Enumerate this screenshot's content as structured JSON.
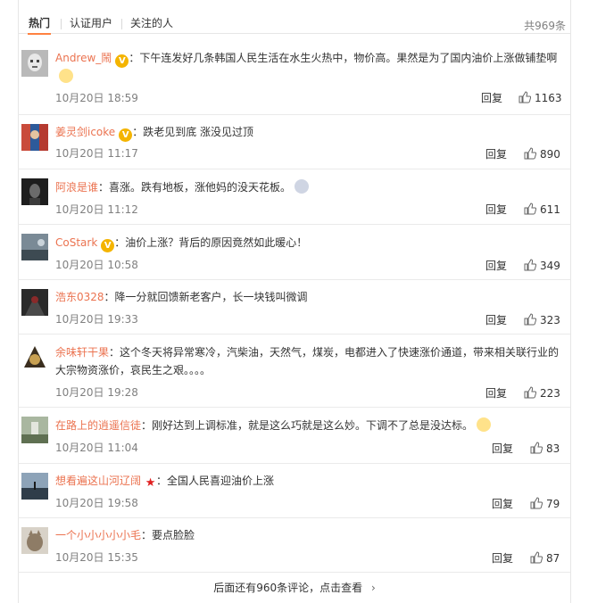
{
  "tabs": [
    "热门",
    "认证用户",
    "关注的人"
  ],
  "total_count": "共969条",
  "colors": {
    "name": "#eb7350",
    "accent_tab": "#ff8140",
    "vip_badge": "#f4b400"
  },
  "comments": [
    {
      "name": "Andrew_鬧",
      "badge": "V",
      "text": "：下午连发好几条韩国人民生活在水生火热中，物价高。果然是为了国内油价上涨做铺垫啊",
      "emoji": "doge-icon",
      "time": "10月20日 18:59",
      "reply": "回复",
      "likes": "1163"
    },
    {
      "name": "姜灵剑icoke",
      "badge": "V",
      "text": "：跌老见到底 涨没见过顶",
      "time": "10月20日 11:17",
      "reply": "回复",
      "likes": "890"
    },
    {
      "name": "阿浪是谁",
      "badge": "",
      "text": "：喜涨。跌有地板，涨他妈的没天花板。",
      "emoji": "shocked-face-icon",
      "time": "10月20日 11:12",
      "reply": "回复",
      "likes": "611"
    },
    {
      "name": "CoStark",
      "badge": "V",
      "text": "：油价上涨？背后的原因竟然如此暖心！",
      "time": "10月20日 10:58",
      "reply": "回复",
      "likes": "349"
    },
    {
      "name": "浩东0328",
      "badge": "",
      "text": "：降一分就回馈新老客户，长一块钱叫微调",
      "time": "10月20日 19:33",
      "reply": "回复",
      "likes": "323"
    },
    {
      "name": "余味轩干果",
      "badge": "",
      "text": "：这个冬天将异常寒冷，汽柴油，天然气，煤炭，电都进入了快速涨价通道，带来相关联行业的大宗物资涨价，哀民生之艰。。。。",
      "time": "10月20日 19:28",
      "reply": "回复",
      "likes": "223"
    },
    {
      "name": "在路上的逍遥信徒",
      "badge": "",
      "text": "：刚好达到上调标准，就是这么巧就是这么妙。下调不了总是没达标。",
      "emoji": "thinking-face-icon",
      "time": "10月20日 11:04",
      "reply": "回复",
      "likes": "83"
    },
    {
      "name": "想看遍这山河辽阔",
      "badge": "★",
      "text": "：全国人民喜迎油价上涨",
      "time": "10月20日 19:58",
      "reply": "回复",
      "likes": "79"
    },
    {
      "name": "一个小小小小小毛",
      "badge": "",
      "text": "：要点脸脸",
      "time": "10月20日 15:35",
      "reply": "回复",
      "likes": "87"
    }
  ],
  "more_link": "后面还有960条评论，点击查看",
  "more_chevron": "›"
}
